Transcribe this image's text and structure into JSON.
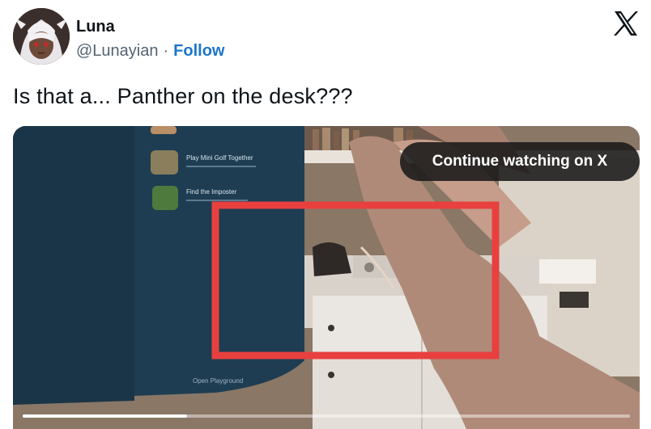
{
  "author": {
    "name": "Luna",
    "handle": "@Lunayian",
    "separator": "·",
    "follow_label": "Follow",
    "avatar_icon": "anime-avatar-icon"
  },
  "platform_icon": "x-logo-icon",
  "tweet": {
    "text": "Is that a... Panther on the desk???"
  },
  "video": {
    "continue_label": "Continue watching on X",
    "progress": 0.27,
    "highlight_color": "#e8403f",
    "screen_items": [
      "Play Mini Golf Together",
      "Find the Imposter"
    ],
    "screen_footer": "Open Playground"
  },
  "colors": {
    "follow": "#1d76c9",
    "text": "#0f1419",
    "secondary": "#536471"
  }
}
